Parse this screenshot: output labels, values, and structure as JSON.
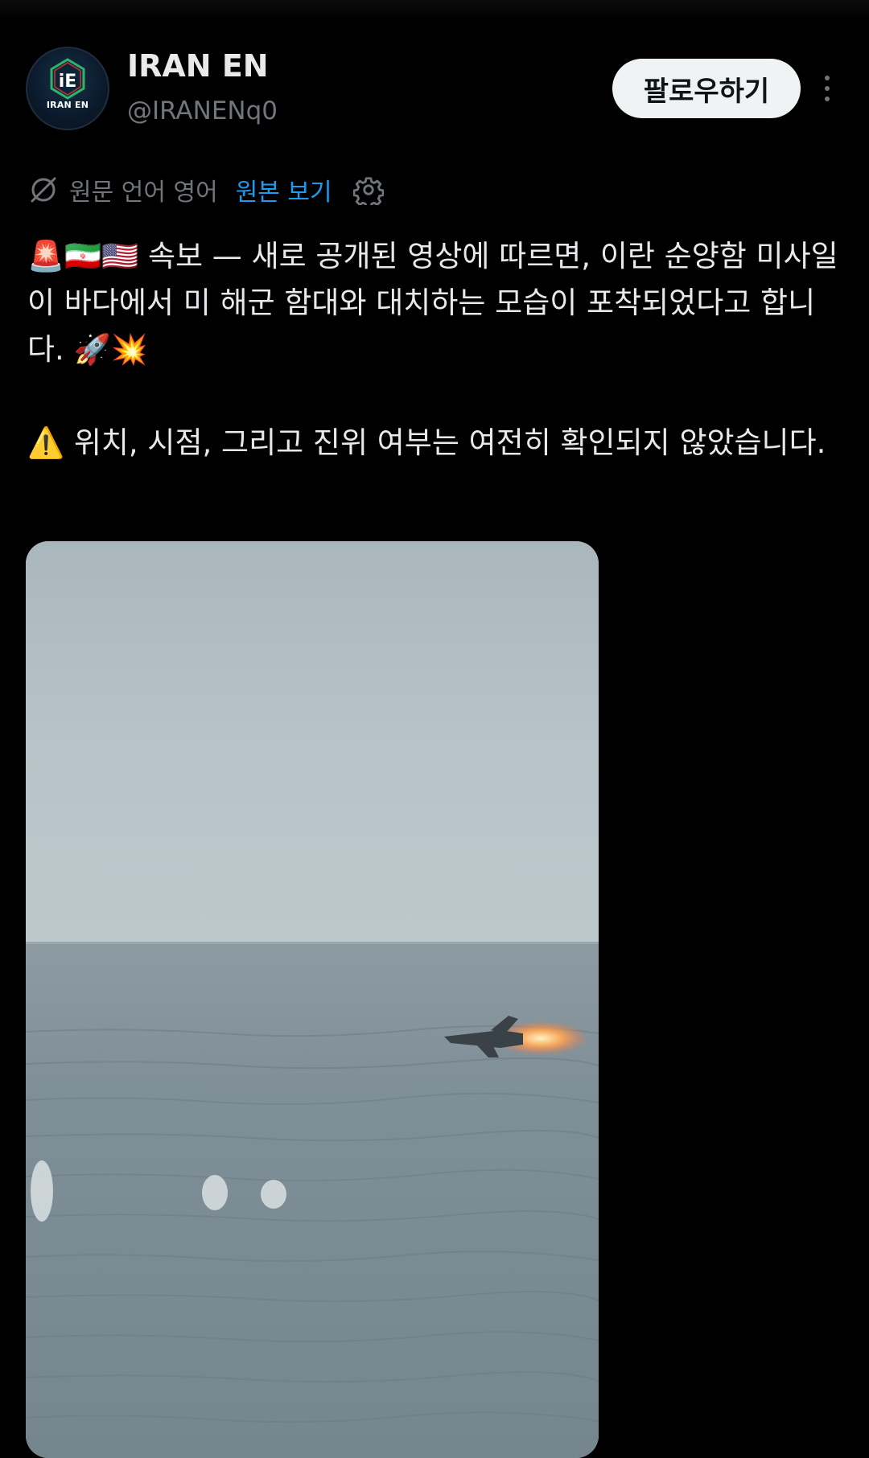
{
  "author": {
    "display_name": "IRAN EN",
    "handle": "@IRANENq0",
    "avatar_initials": "iE",
    "avatar_label": "IRAN EN"
  },
  "actions": {
    "follow_label": "팔로우하기",
    "more_icon": "more-vertical-icon"
  },
  "translation": {
    "icon": "translate-icon",
    "label": "원문 언어 영어",
    "show_original_label": "원본 보기",
    "settings_icon": "gear-icon"
  },
  "post": {
    "paragraph_1": "🚨🇮🇷🇺🇸 속보 — 새로 공개된 영상에 따르면, 이란 순양함 미사일이 바다에서 미 해군 함대와 대치하는 모습이 포착되었다고 합니다. 🚀💥",
    "paragraph_2": "⚠️ 위치, 시점, 그리고 진위 여부는 여전히 확인되지 않았습니다."
  },
  "media": {
    "type": "video-still",
    "content": "missile-over-sea"
  },
  "colors": {
    "background": "#000000",
    "text_primary": "#e7e9ea",
    "text_secondary": "#71767b",
    "link_blue": "#1d9bf0",
    "follow_button_bg": "#eff3f4"
  }
}
